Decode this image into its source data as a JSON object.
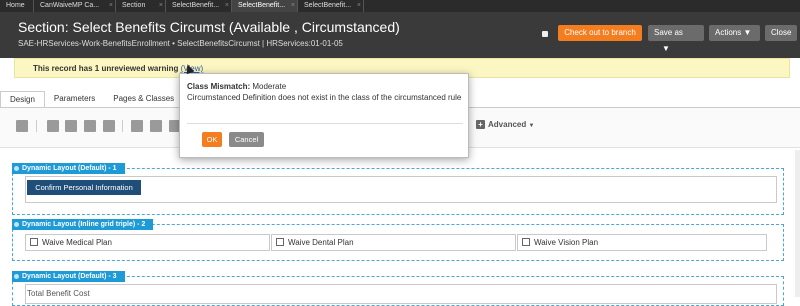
{
  "top_tabs": [
    {
      "label": "Home"
    },
    {
      "label": "CanWaiveMP Ca..."
    },
    {
      "label": "Section"
    },
    {
      "label": "SelectBenefit..."
    },
    {
      "label": "SelectBenefit..."
    },
    {
      "label": "SelectBenefit..."
    }
  ],
  "header": {
    "title": "Section: Select Benefits Circumst (Available , Circumstanced)",
    "subtitle": "SAE-HRServices-Work-BenefitsEnrollment • SelectBenefitsCircumst | HRServices:01-01-05",
    "checkout_label": "Check out to branch",
    "save_as_label": "Save as",
    "actions_label": "Actions",
    "close_label": "Close"
  },
  "warning": {
    "text": "This record has 1 unreviewed warning",
    "link": "(View)"
  },
  "rule_tabs": [
    "Design",
    "Parameters",
    "Pages & Classes"
  ],
  "toolbar": {
    "advanced_label": "Advanced"
  },
  "layouts": [
    {
      "label": "Dynamic Layout (Default) -    1"
    },
    {
      "label": "Dynamic Layout (Inline grid triple) -    2"
    },
    {
      "label": "Dynamic Layout (Default) -    3"
    }
  ],
  "confirm_button": "Confirm Personal Information",
  "checkboxes": [
    "Waive Medical Plan",
    "Waive Dental Plan",
    "Waive Vision Plan"
  ],
  "total_label": "Total Benefit Cost",
  "modal": {
    "title_bold": "Class Mismatch:",
    "title_rest": " Moderate",
    "body": "Circumstanced Definition does not exist in the class of the circumstanced rule",
    "ok_label": "OK",
    "cancel_label": "Cancel"
  },
  "colors": {
    "accent": "#f47d20",
    "layout_label": "#1e9ad6",
    "header_bg": "#3a3a3a",
    "warning_bg": "#fcf6c2"
  }
}
